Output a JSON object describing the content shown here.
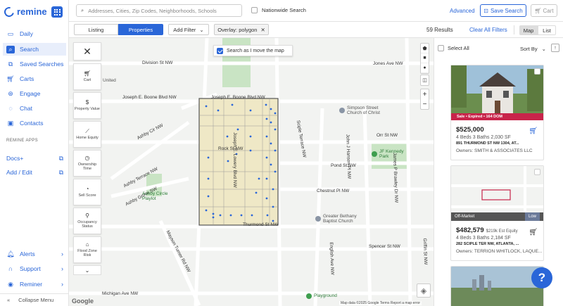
{
  "app": {
    "brand": "remine"
  },
  "sidebar": {
    "items": [
      {
        "label": "Daily",
        "icon": "calendar-icon"
      },
      {
        "label": "Search",
        "icon": "search-icon"
      },
      {
        "label": "Saved Searches",
        "icon": "bookmark-icon"
      },
      {
        "label": "Carts",
        "icon": "cart-icon"
      },
      {
        "label": "Engage",
        "icon": "handshake-icon"
      },
      {
        "label": "Chat",
        "icon": "chat-icon"
      },
      {
        "label": "Contacts",
        "icon": "contacts-icon"
      }
    ],
    "apps_title": "REMINE APPS",
    "apps": [
      {
        "label": "Docs+"
      },
      {
        "label": "Add / Edit"
      }
    ],
    "bottom": [
      {
        "label": "Alerts",
        "icon": "bell-icon"
      },
      {
        "label": "Support",
        "icon": "headset-icon"
      },
      {
        "label": "Reminer",
        "icon": "user-icon"
      }
    ],
    "collapse_label": "Collapse Menu"
  },
  "topbar": {
    "search_placeholder": "Addresses, Cities, Zip Codes, Neighborhoods, Schools",
    "nationwide_label": "Nationwide Search",
    "advanced_label": "Advanced",
    "save_search_label": "Save Search",
    "cart_label": "Cart"
  },
  "filterbar": {
    "tab_listing": "Listing",
    "tab_properties": "Properties",
    "add_filter": "Add Filter",
    "overlay_chip": "Overlay: polygon",
    "results_count": "59 Results",
    "clear_filters": "Clear All Filters",
    "view_map": "Map",
    "view_list": "List"
  },
  "map": {
    "search_as_move": "Search as I move the map",
    "controls": [
      {
        "label": "Cart",
        "icon": "cart-icon"
      },
      {
        "label": "Property Value",
        "icon": "dollar-icon"
      },
      {
        "label": "Home Equity",
        "icon": "chart-icon"
      },
      {
        "label": "Ownership Time",
        "icon": "clock-icon"
      },
      {
        "label": "Sell Score",
        "icon": "score-icon"
      },
      {
        "label": "Occupancy Status",
        "icon": "occupancy-icon"
      },
      {
        "label": "Flood Zone Risk",
        "icon": "flood-icon"
      }
    ],
    "streets": {
      "division": "Division St NW",
      "jones": "Jones Ave NW",
      "boone_left": "Joseph E. Boone Blvd NW",
      "boone_mid": "Joseph E. Boone Blvd NW",
      "orr": "Orr St NW",
      "ashby_cir": "Ashby Cir NW",
      "ashby_terrace": "Ashby Terrace NW",
      "ashby_grove": "Ashby Grove SW",
      "rock": "Rock St NW",
      "pond": "Pond St NW",
      "chestnut": "Chestnut Pl NW",
      "thurmond": "Thurmond St NW",
      "spencer": "Spencer St NW",
      "michigan": "Michigan Ave NW",
      "lowery": "Joseph E. Lowery Blvd NW",
      "sciple": "Sciple Terrace NW",
      "hanson": "John J Hanson Pl NW",
      "brawley": "James P Brawley Dr NW",
      "maddox": "Mayson Turner Rd NW",
      "griffin": "Griffin St NW",
      "english": "English Ave NW"
    },
    "pois": {
      "church": "Simpson Street Church of Christ",
      "park": "JF Kennedy Park",
      "ashby_park": "Ashby Circle Playlot",
      "gb_church": "Greater Bethany Baptist Church",
      "playground": "Playground",
      "united": "United"
    },
    "google": "Google",
    "attribution": "Map data ©2025 Google   Terms   Report a map error"
  },
  "results_panel": {
    "select_all": "Select All",
    "sort_by": "Sort By",
    "cards": [
      {
        "tag": "Sale • Expired • 164 DOM",
        "price": "$525,000",
        "equity": "",
        "beds": "4 Beds 3 Baths 2,030 SF",
        "address": "891 THURMOND ST NW 1304, AT...",
        "owner": "Owners: SMITH & ASSOCIATES LLC"
      },
      {
        "tag": "Off-Market",
        "badge": "Low",
        "price": "$482,579",
        "equity": "$219k Est Equity",
        "beds": "4 Beds 3 Baths 2,184 SF",
        "address": "282 SCIPLE TER NW, ATLANTA, ...",
        "owner": "Owners: TERRION WHITLOCK, LAQUE..."
      }
    ],
    "help": "?"
  },
  "colors": {
    "accent": "#2a66d8",
    "sale_tag": "#c8244a",
    "parcel_fill": "#efe8c6",
    "park": "#c9e4c4"
  }
}
